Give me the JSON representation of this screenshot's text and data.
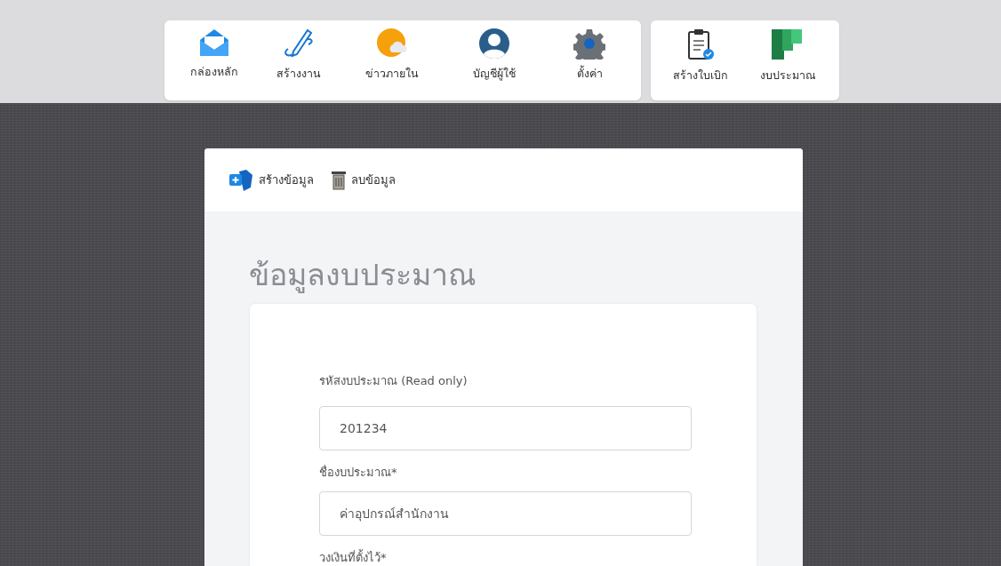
{
  "nav_groups": [
    {
      "items": [
        {
          "label": "กล่องหลัก"
        },
        {
          "label": "สร้างงาน"
        },
        {
          "label": "ข่าวภายใน"
        },
        {
          "label": "บัญชีผู้ใช้"
        },
        {
          "label": "ตั้งค่า"
        }
      ]
    },
    {
      "items": [
        {
          "label": "สร้างใบเบิก"
        },
        {
          "label": "งบประมาณ"
        }
      ]
    }
  ],
  "toolbar": [
    {
      "kind": "create",
      "label": "สร้างข้อมูล"
    },
    {
      "kind": "delete",
      "label": "ลบข้อมูล"
    }
  ],
  "page_title": "ข้อมูลงบประมาณ",
  "form": {
    "fields": [
      {
        "label": "รหัสงบประมาณ (Read only)",
        "value": "201234"
      },
      {
        "label": "ชื่องบประมาณ*",
        "value": "ค่าอุปกรณ์สำนักงาน"
      },
      {
        "label": "วงเงินที่ตั้งไว้*"
      }
    ]
  }
}
